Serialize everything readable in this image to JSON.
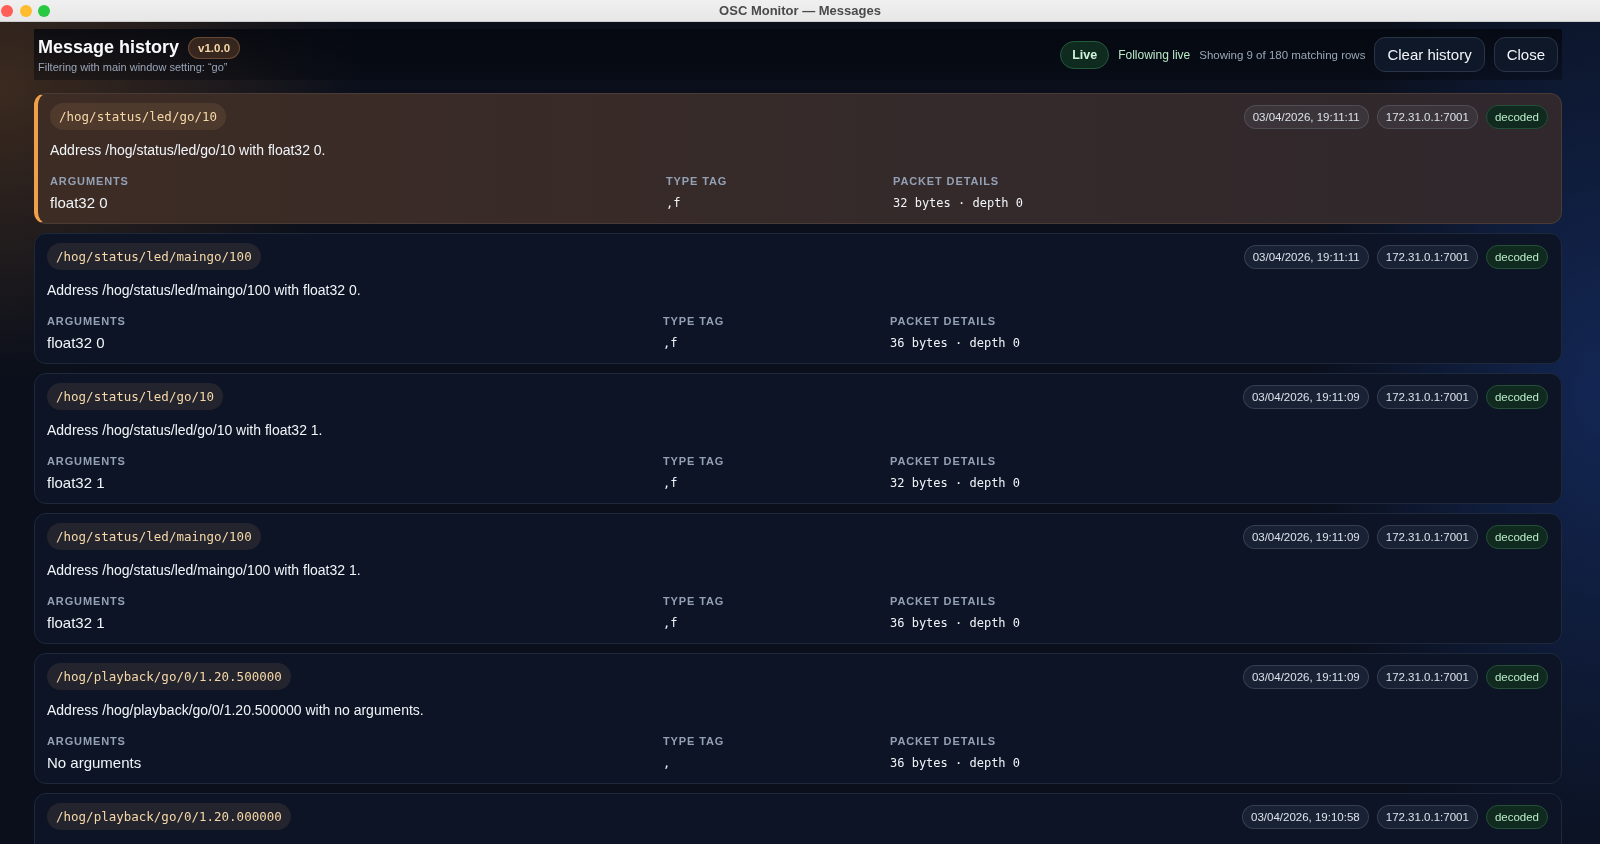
{
  "window": {
    "title": "OSC Monitor — Messages"
  },
  "header": {
    "title": "Message history",
    "version": "v1.0.0",
    "subtitle": "Filtering with main window setting: “go”",
    "live_badge": "Live",
    "follow_status": "Following live",
    "row_count": "Showing 9 of 180 matching rows",
    "buttons": [
      {
        "label": "Clear history"
      },
      {
        "label": "Close"
      }
    ]
  },
  "messages": [
    {
      "selected": true,
      "address": "/hog/status/led/go/10",
      "timestamp": "03/04/2026, 19:11:11",
      "source": "172.31.0.1:7001",
      "status": "decoded",
      "description": "Address /hog/status/led/go/10 with float32 0.",
      "fields": [
        {
          "kind": "text",
          "label": "ARGUMENTS",
          "value": "float32 0"
        },
        {
          "kind": "code",
          "label": "TYPE TAG",
          "value": ",f"
        },
        {
          "kind": "code",
          "label": "PACKET DETAILS",
          "value": "32 bytes · depth 0"
        }
      ]
    },
    {
      "selected": false,
      "address": "/hog/status/led/maingo/100",
      "timestamp": "03/04/2026, 19:11:11",
      "source": "172.31.0.1:7001",
      "status": "decoded",
      "description": "Address /hog/status/led/maingo/100 with float32 0.",
      "fields": [
        {
          "kind": "text",
          "label": "ARGUMENTS",
          "value": "float32 0"
        },
        {
          "kind": "code",
          "label": "TYPE TAG",
          "value": ",f"
        },
        {
          "kind": "code",
          "label": "PACKET DETAILS",
          "value": "36 bytes · depth 0"
        }
      ]
    },
    {
      "selected": false,
      "address": "/hog/status/led/go/10",
      "timestamp": "03/04/2026, 19:11:09",
      "source": "172.31.0.1:7001",
      "status": "decoded",
      "description": "Address /hog/status/led/go/10 with float32 1.",
      "fields": [
        {
          "kind": "text",
          "label": "ARGUMENTS",
          "value": "float32 1"
        },
        {
          "kind": "code",
          "label": "TYPE TAG",
          "value": ",f"
        },
        {
          "kind": "code",
          "label": "PACKET DETAILS",
          "value": "32 bytes · depth 0"
        }
      ]
    },
    {
      "selected": false,
      "address": "/hog/status/led/maingo/100",
      "timestamp": "03/04/2026, 19:11:09",
      "source": "172.31.0.1:7001",
      "status": "decoded",
      "description": "Address /hog/status/led/maingo/100 with float32 1.",
      "fields": [
        {
          "kind": "text",
          "label": "ARGUMENTS",
          "value": "float32 1"
        },
        {
          "kind": "code",
          "label": "TYPE TAG",
          "value": ",f"
        },
        {
          "kind": "code",
          "label": "PACKET DETAILS",
          "value": "36 bytes · depth 0"
        }
      ]
    },
    {
      "selected": false,
      "address": "/hog/playback/go/0/1.20.500000",
      "timestamp": "03/04/2026, 19:11:09",
      "source": "172.31.0.1:7001",
      "status": "decoded",
      "description": "Address /hog/playback/go/0/1.20.500000 with no arguments.",
      "fields": [
        {
          "kind": "text",
          "label": "ARGUMENTS",
          "value": "No arguments"
        },
        {
          "kind": "code",
          "label": "TYPE TAG",
          "value": ","
        },
        {
          "kind": "code",
          "label": "PACKET DETAILS",
          "value": "36 bytes · depth 0"
        }
      ]
    },
    {
      "selected": false,
      "address": "/hog/playback/go/0/1.20.000000",
      "timestamp": "03/04/2026, 19:10:58",
      "source": "172.31.0.1:7001",
      "status": "decoded"
    }
  ]
}
